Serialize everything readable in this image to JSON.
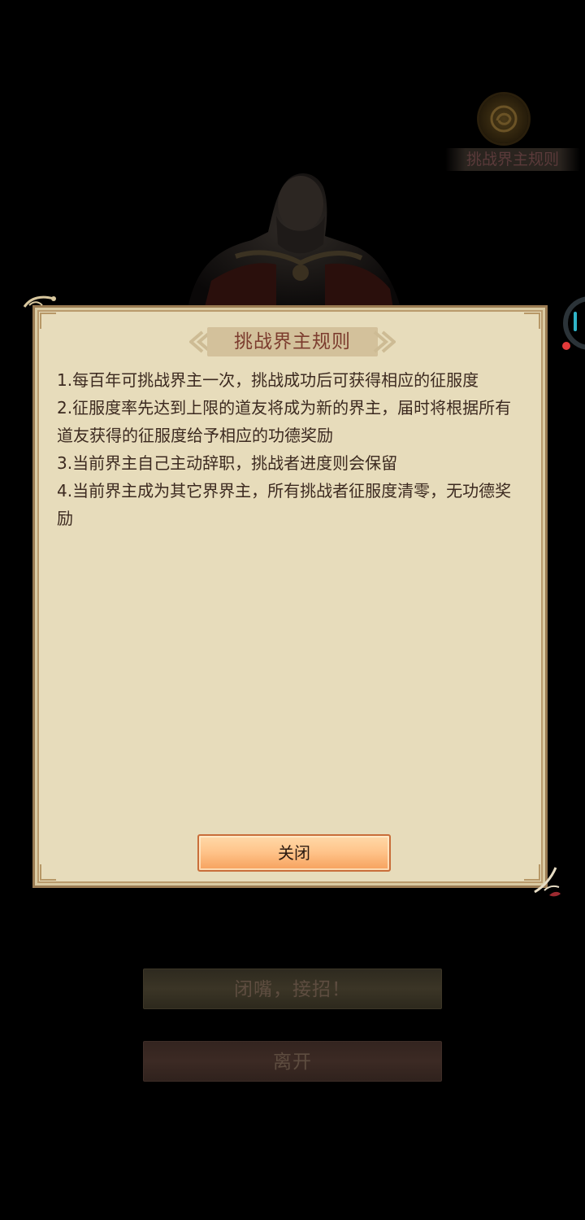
{
  "top_right": {
    "rules_button_label": "挑战界主规则",
    "icon": "rules-emblem-icon"
  },
  "dialog": {
    "title": "挑战界主规则",
    "rules": [
      "1.每百年可挑战界主一次，挑战成功后可获得相应的征服度",
      "2.征服度率先达到上限的道友将成为新的界主，届时将根据所有道友获得的征服度给予相应的功德奖励",
      "3.当前界主自己主动辞职，挑战者进度则会保留",
      "4.当前界主成为其它界界主，所有挑战者征服度清零，无功德奖励"
    ],
    "close_label": "关闭"
  },
  "bottom": {
    "fight_label": "闭嘴，接招！",
    "leave_label": "离开"
  },
  "colors": {
    "dialog_bg": "#e7dcbb",
    "dialog_border": "#9a7b52",
    "title_color": "#7c3c2e",
    "text_color": "#3c2a20",
    "close_btn": "#f6a15d"
  }
}
